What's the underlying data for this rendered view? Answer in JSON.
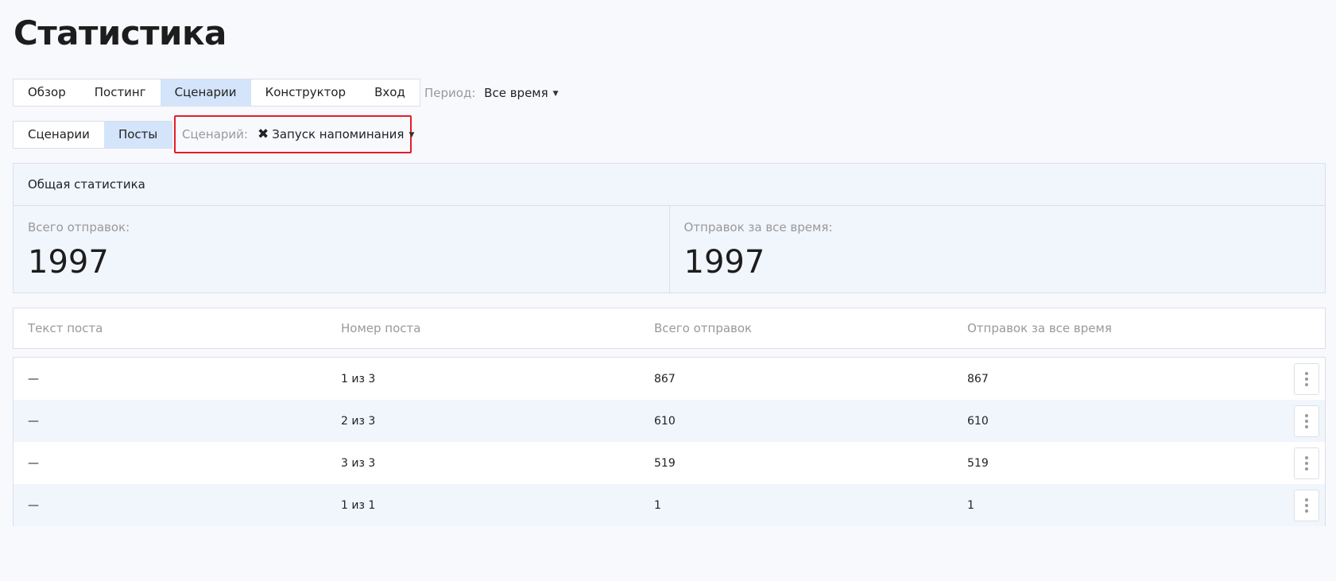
{
  "page": {
    "title": "Статистика"
  },
  "main_tabs": [
    {
      "label": "Обзор",
      "active": false
    },
    {
      "label": "Постинг",
      "active": false
    },
    {
      "label": "Сценарии",
      "active": true
    },
    {
      "label": "Конструктор",
      "active": false
    },
    {
      "label": "Вход",
      "active": false
    }
  ],
  "period": {
    "label": "Период:",
    "value": "Все время"
  },
  "sub_tabs": [
    {
      "label": "Сценарии",
      "active": false
    },
    {
      "label": "Посты",
      "active": true
    }
  ],
  "scenario": {
    "label": "Сценарий:",
    "value": "Запуск напоминания"
  },
  "stats": {
    "header": "Общая статистика",
    "total_label": "Всего отправок:",
    "total_value": "1997",
    "alltime_label": "Отправок за все время:",
    "alltime_value": "1997"
  },
  "table": {
    "columns": [
      "Текст поста",
      "Номер поста",
      "Всего отправок",
      "Отправок за все время"
    ],
    "rows": [
      [
        "—",
        "1 из 3",
        "867",
        "867"
      ],
      [
        "—",
        "2 из 3",
        "610",
        "610"
      ],
      [
        "—",
        "3 из 3",
        "519",
        "519"
      ],
      [
        "—",
        "1 из 1",
        "1",
        "1"
      ]
    ]
  },
  "colors": {
    "active_tab": "#d4e4fb",
    "highlight_border": "#e41e26",
    "stripe": "#f1f5fc"
  },
  "icons": {
    "clear": "close-icon",
    "dropdown": "caret-down-icon",
    "row_menu": "kebab-menu-icon"
  }
}
